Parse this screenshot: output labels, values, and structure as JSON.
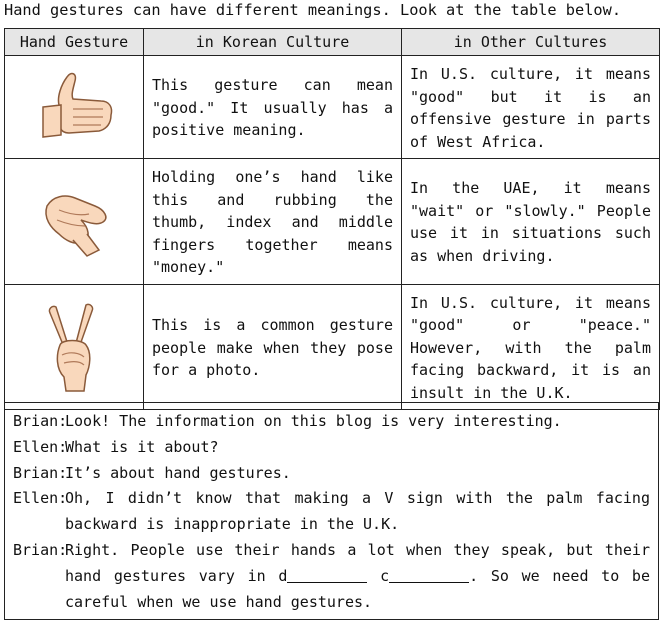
{
  "intro": "Hand gestures can have different meanings. Look at the table below.",
  "table": {
    "headers": [
      "Hand Gesture",
      "in Korean Culture",
      "in Other Cultures"
    ],
    "rows": [
      {
        "icon": "thumbs-up-hand",
        "korean": "This gesture can mean \"good.\" It usually has a positive meaning.",
        "other": "In U.S. culture, it means \"good\" but it is an offensive gesture in parts of West Africa."
      },
      {
        "icon": "money-rubbing-fingers-hand",
        "korean": "Holding one’s hand like this and rubbing the thumb, index and middle fingers together means \"money.\"",
        "other": "In the UAE, it means \"wait\" or \"slowly.\" People use it in situations such as when driving."
      },
      {
        "icon": "v-sign-hand",
        "korean": "This is a common gesture people make when they pose for a photo.",
        "other": "In U.S. culture, it means \"good\" or \"peace.\" However, with the palm facing backward, it is an insult in the U.K."
      }
    ]
  },
  "dialog": [
    {
      "speaker": "Brian:",
      "text": "Look! The information on this blog is very interesting."
    },
    {
      "speaker": "Ellen:",
      "text": "What is it about?"
    },
    {
      "speaker": "Brian:",
      "text": "It’s about hand gestures."
    },
    {
      "speaker": "Ellen:",
      "text": "Oh, I didn’t know that making a V sign with the palm facing backward is inappropriate in the U.K."
    },
    {
      "speaker": "Brian:",
      "text_before": "Right. People use their hands a lot when they speak, but their hand gestures vary in d",
      "text_mid": " c",
      "text_after": ". So we need to be careful when we use hand gestures."
    }
  ]
}
